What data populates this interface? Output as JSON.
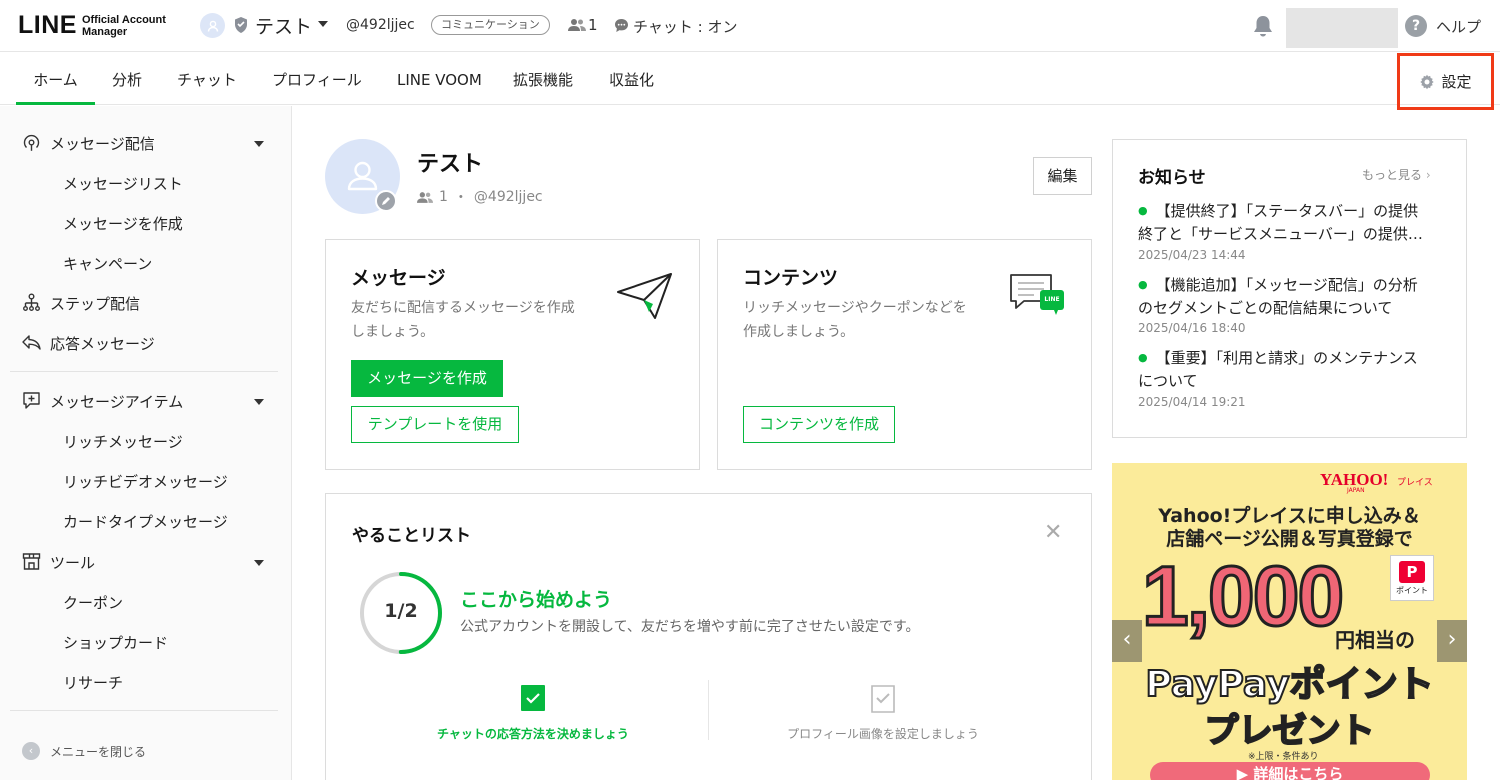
{
  "header": {
    "logo_main": "LINE",
    "logo_sub_1": "Official Account",
    "logo_sub_2": "Manager",
    "account_name": "テスト",
    "account_id": "@492ljjec",
    "plan_badge": "コミュニケーション",
    "friends_count": "1",
    "chat_status": "チャット : オン",
    "help_label": "ヘルプ"
  },
  "nav": {
    "tabs": [
      "ホーム",
      "分析",
      "チャット",
      "プロフィール",
      "LINE VOOM",
      "拡張機能",
      "収益化"
    ],
    "active_tab": "ホーム",
    "settings_label": "設定"
  },
  "sidebar": {
    "sections": [
      {
        "label": "メッセージ配信",
        "icon": "broadcast-icon",
        "items": [
          "メッセージリスト",
          "メッセージを作成",
          "キャンペーン"
        ]
      },
      {
        "label": "ステップ配信",
        "icon": "step-icon"
      },
      {
        "label": "応答メッセージ",
        "icon": "reply-icon"
      },
      {
        "label": "メッセージアイテム",
        "icon": "message-item-icon",
        "items": [
          "リッチメッセージ",
          "リッチビデオメッセージ",
          "カードタイプメッセージ"
        ]
      },
      {
        "label": "ツール",
        "icon": "store-icon",
        "items": [
          "クーポン",
          "ショップカード",
          "リサーチ"
        ]
      }
    ],
    "close_menu": "メニューを閉じる"
  },
  "profile": {
    "name": "テスト",
    "friends": "1",
    "separator": "・",
    "id": "@492ljjec",
    "edit_label": "編集"
  },
  "message_card": {
    "title": "メッセージ",
    "desc_1": "友だちに配信するメッセージを作成",
    "desc_2": "しましょう。",
    "primary_btn": "メッセージを作成",
    "secondary_btn": "テンプレートを使用"
  },
  "content_card": {
    "title": "コンテンツ",
    "desc_1": "リッチメッセージやクーポンなどを",
    "desc_2": "作成しましょう。",
    "btn": "コンテンツを作成",
    "icon_badge": "LINE"
  },
  "todo": {
    "title": "やることリスト",
    "progress_label": "1/2",
    "progress_fraction": 0.5,
    "heading": "ここから始めよう",
    "description": "公式アカウントを開設して、友だちを増やす前に完了させたい設定です。",
    "steps": [
      {
        "label": "チャットの応答方法を決めましょう",
        "done": true
      },
      {
        "label": "プロフィール画像を設定しましょう",
        "done": false
      }
    ]
  },
  "news": {
    "title": "お知らせ",
    "more": "もっと見る",
    "items": [
      {
        "line1": "【提供終了】「ステータスバー」の提供",
        "line2": "終了と「サービスメニューバー」の提供…",
        "date": "2025/04/23 14:44"
      },
      {
        "line1": "【機能追加】「メッセージ配信」の分析",
        "line2": "のセグメントごとの配信結果について",
        "date": "2025/04/16 18:40"
      },
      {
        "line1": "【重要】「利用と請求」のメンテナンス",
        "line2": "について",
        "date": "2025/04/14 19:21"
      }
    ]
  },
  "banner": {
    "brand": "YAHOO!",
    "brand_place": "プレイス",
    "brand_japan": "JAPAN",
    "line1": "Yahoo!プレイスに申し込み＆",
    "line2": "店舗ページ公開＆写真登録で",
    "amount": "1,000",
    "unit": "円相当の",
    "paypay_badge": "P",
    "paypay_badge_sub": "ポイント",
    "product": "PayPayポイント",
    "present": "プレゼント",
    "note": "※上限・条件あり",
    "cta": "▶ 詳細はこちら",
    "prev": "‹",
    "next": "›"
  },
  "colors": {
    "brand_green": "#06b83f",
    "highlight_red": "#f03a17",
    "banner_bg": "#fbeb9a"
  }
}
